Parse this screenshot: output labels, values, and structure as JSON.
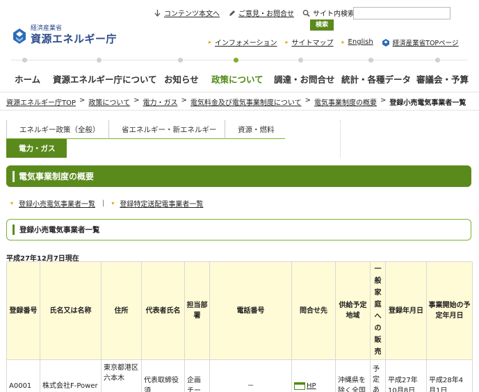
{
  "logo": {
    "sub": "経済産業省",
    "main": "資源エネルギー庁"
  },
  "util": {
    "skip_label": "コンテンツ本文へ",
    "opinion_label": "ご意見・お問合せ",
    "search_label": "サイト内検索",
    "search_value": "",
    "search_button": "検索"
  },
  "util_links": [
    {
      "label": "インフォメーション"
    },
    {
      "label": "サイトマップ"
    },
    {
      "label": "English"
    },
    {
      "label": "経済産業省TOPページ"
    }
  ],
  "gnav": [
    {
      "label": "ホーム"
    },
    {
      "label": "資源エネルギー庁について"
    },
    {
      "label": "お知らせ"
    },
    {
      "label": "政策について"
    },
    {
      "label": "調達・お問合せ"
    },
    {
      "label": "統計・各種データ"
    },
    {
      "label": "審議会・予算"
    }
  ],
  "breadcrumb": [
    {
      "label": "資源エネルギー庁TOP"
    },
    {
      "label": "政策について"
    },
    {
      "label": "電力・ガス"
    },
    {
      "label": "電気料金及び電気事業制度について"
    },
    {
      "label": "電気事業制度の概要"
    },
    {
      "label": "登録小売電気事業者一覧"
    }
  ],
  "breadcrumb_sep": ">",
  "category_tabs": [
    {
      "label": "エネルギー政策（全般）"
    },
    {
      "label": "省エネルギー・新エネルギー"
    },
    {
      "label": "資源・燃料"
    },
    {
      "label": "電力・ガス"
    }
  ],
  "section_title": "電気事業制度の概要",
  "sub_links": [
    {
      "label": "登録小売電気事業者一覧"
    },
    {
      "label": "登録特定送配電事業者一覧"
    }
  ],
  "sub_sep": "|",
  "sub_title": "登録小売電気事業者一覧",
  "as_of": "平成27年12月7日現在",
  "table": {
    "headers": [
      "登録番号",
      "氏名又は名称",
      "住所",
      "代表者氏名",
      "担当部署",
      "電話番号",
      "問合せ先",
      "供給予定地域",
      "一般家庭への販売",
      "登録年月日",
      "事業開始の予定年月日"
    ],
    "rows": [
      [
        "A0001",
        "株式会社F-Power",
        "東京都港区六本木",
        "代表取締役 須",
        "企画チーム",
        "－",
        "HP",
        "沖縄県を除く全国",
        "予定あり",
        "平成27年10月8日",
        "平成28年4月1日"
      ]
    ]
  },
  "colors": {
    "brand_green": "#5a8a1c",
    "accent_green": "#7ab22b",
    "header_yellow": "#fffbd6",
    "arrow_orange": "#e8a000",
    "logo_blue": "#2b4a8a"
  }
}
